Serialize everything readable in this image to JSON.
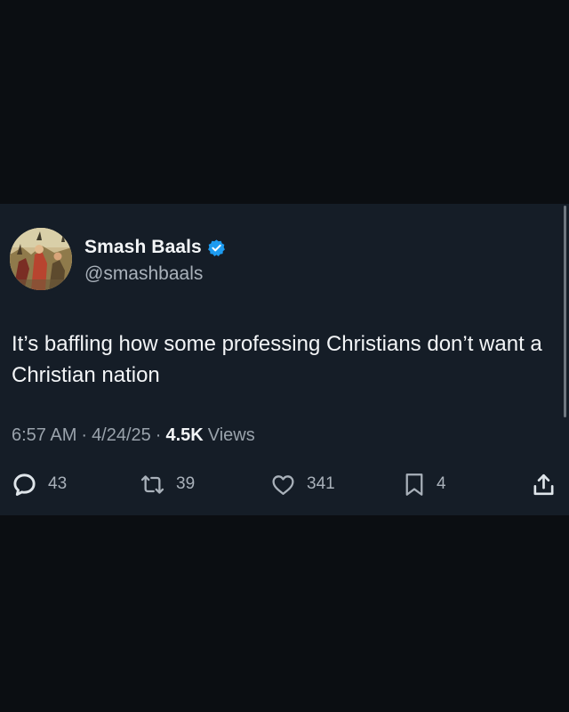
{
  "tweet": {
    "display_name": "Smash Baals",
    "handle": "@smashbaals",
    "verified": true,
    "verified_color": "#1d9bf0",
    "text": "It’s baffling how some professing Christians don’t want a Christian nation",
    "time": "6:57 AM",
    "date": "4/24/25",
    "separator": "·",
    "views_count": "4.5K",
    "views_label": "Views"
  },
  "actions": {
    "replies": "43",
    "retweets": "39",
    "likes": "341",
    "bookmarks": "4"
  },
  "icons": {
    "reply": "reply-icon",
    "retweet": "retweet-icon",
    "like": "heart-icon",
    "bookmark": "bookmark-icon",
    "share": "share-icon",
    "verified": "verified-badge-icon"
  },
  "colors": {
    "page_background": "#0b0e12",
    "card_background": "#151d27",
    "primary_text": "#f3f5f7",
    "secondary_text": "#a9b1ba"
  }
}
